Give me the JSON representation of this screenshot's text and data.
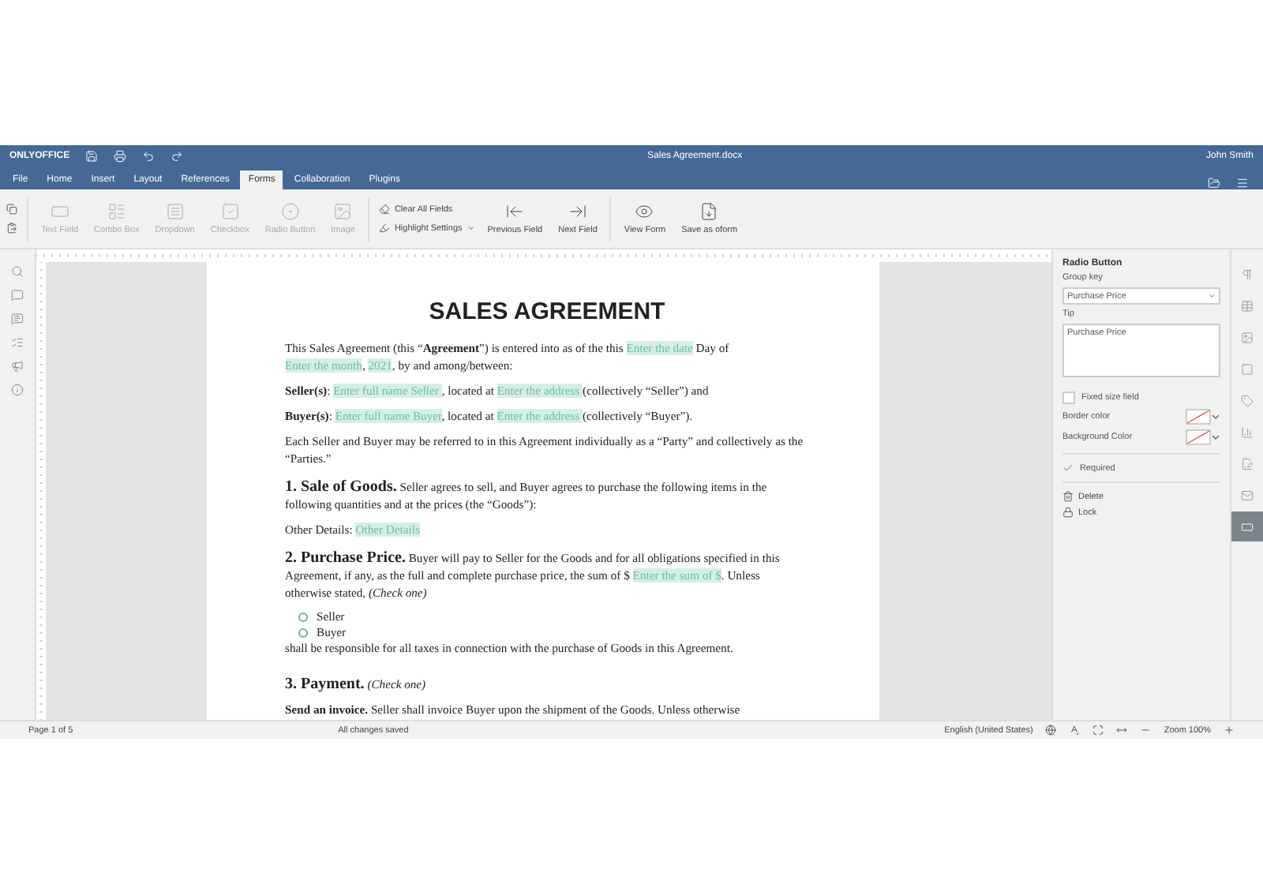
{
  "titlebar": {
    "logo": "ONLYOFFICE",
    "title": "Sales Agreement.docx",
    "user": "John Smith"
  },
  "tabs": [
    {
      "label": "File",
      "selected": false
    },
    {
      "label": "Home",
      "selected": false
    },
    {
      "label": "Insert",
      "selected": false
    },
    {
      "label": "Layout",
      "selected": false
    },
    {
      "label": "References",
      "selected": false
    },
    {
      "label": "Forms",
      "selected": true
    },
    {
      "label": "Collaboration",
      "selected": false
    },
    {
      "label": "Plugins",
      "selected": false
    }
  ],
  "toolbar": {
    "insert_controls": [
      {
        "label": "Text Field",
        "disabled": true
      },
      {
        "label": "Combo Box",
        "disabled": true
      },
      {
        "label": "Dropdown",
        "disabled": true
      },
      {
        "label": "Checkbox",
        "disabled": true
      },
      {
        "label": "Radio Button",
        "disabled": true
      },
      {
        "label": "Image",
        "disabled": true
      }
    ],
    "clear_all": "Clear All Fields",
    "highlight": "Highlight Settings",
    "navigation": [
      {
        "label": "Previous Field",
        "disabled": false
      },
      {
        "label": "Next Field",
        "disabled": false
      },
      {
        "label": "View Form",
        "disabled": false
      },
      {
        "label": "Save as oform",
        "disabled": false
      }
    ]
  },
  "document": {
    "title": "SALES AGREEMENT",
    "paragraphs": [
      {
        "kind": "body",
        "segments": [
          {
            "kind": "text",
            "text": "This Sales Agreement (this “**Agreement**”) is entered into as of the this "
          },
          {
            "kind": "field",
            "text": "Enter the date"
          },
          {
            "kind": "text",
            "text": " Day of "
          },
          {
            "kind": "field",
            "text": "Enter the month"
          },
          {
            "kind": "text",
            "text": ", "
          },
          {
            "kind": "field",
            "text": "2021"
          },
          {
            "kind": "text",
            "text": ",  by and among/between:"
          }
        ]
      },
      {
        "kind": "body",
        "segments": [
          {
            "kind": "text",
            "text": "**Seller(s)**: "
          },
          {
            "kind": "field",
            "text": "Enter full name Seller "
          },
          {
            "kind": "text",
            "text": ", located at "
          },
          {
            "kind": "field",
            "text": "Enter the address "
          },
          {
            "kind": "text",
            "text": " (collectively “Seller”) and"
          }
        ]
      },
      {
        "kind": "body",
        "segments": [
          {
            "kind": "text",
            "text": "**Buyer(s)**: "
          },
          {
            "kind": "field",
            "text": "Enter full name Buyer"
          },
          {
            "kind": "text",
            "text": ", located at "
          },
          {
            "kind": "field",
            "text": "Enter the address "
          },
          {
            "kind": "text",
            "text": " (collectively “Buyer”)."
          }
        ]
      },
      {
        "kind": "body",
        "segments": [
          {
            "kind": "text",
            "text": "Each Seller and Buyer may be referred to in this Agreement individually as a “Party” and collectively as the “Parties.”"
          }
        ]
      },
      {
        "kind": "section",
        "heading": "1. Sale of Goods.",
        "segments": [
          {
            "kind": "text",
            "text": " Seller agrees to sell, and Buyer agrees to purchase the following items in the following quantities and at the prices (the “Goods”):"
          }
        ]
      },
      {
        "kind": "body",
        "segments": [
          {
            "kind": "text",
            "text": "Other Details: "
          },
          {
            "kind": "field",
            "text": "Other Details "
          }
        ]
      },
      {
        "kind": "section",
        "heading": "2. Purchase Price.",
        "segments": [
          {
            "kind": "text",
            "text": " Buyer will pay to Seller for the Goods and for all obligations specified in this Agreement, if any, as the full and complete purchase price, the sum of $ "
          },
          {
            "kind": "field",
            "text": "Enter the sum of $"
          },
          {
            "kind": "text",
            "text": ". Unless otherwise stated, *(Check one)*"
          }
        ]
      },
      {
        "kind": "radios",
        "options": [
          {
            "label": "Seller",
            "selected": false
          },
          {
            "label": "Buyer",
            "selected": false
          }
        ]
      },
      {
        "kind": "tight",
        "segments": [
          {
            "kind": "text",
            "text": "shall be responsible for all taxes in connection with the purchase of Goods in this Agreement."
          }
        ]
      },
      {
        "kind": "section",
        "heading": "3. Payment.",
        "segments": [
          {
            "kind": "text",
            "text": " *(Check one)*"
          }
        ]
      },
      {
        "kind": "tight",
        "segments": [
          {
            "kind": "text",
            "text": "  **Send an invoice.** Seller shall invoice Buyer upon the shipment of the Goods. Unless otherwise"
          }
        ]
      }
    ]
  },
  "settings": {
    "title": "Radio Button",
    "group_key_label": "Group key",
    "group_key": "Purchase Price",
    "tip_label": "Tip",
    "tip": "Purchase Price",
    "fixed_size": {
      "label": "Fixed size field",
      "checked": false
    },
    "border_color": "Border color",
    "background_color": "Background Color",
    "required": {
      "label": "Required",
      "checked": true
    },
    "delete": "Delete",
    "lock": "Lock"
  },
  "right_bar": [
    {
      "selected": false
    },
    {
      "selected": false
    },
    {
      "selected": false
    },
    {
      "selected": false
    },
    {
      "selected": false
    },
    {
      "selected": false
    },
    {
      "selected": false
    },
    {
      "selected": false
    },
    {
      "selected": true
    }
  ],
  "status_bar": {
    "page": "Page 1 of 5",
    "saved": "All changes saved",
    "language": "English (United States)",
    "zoom": "Zoom 100%"
  }
}
